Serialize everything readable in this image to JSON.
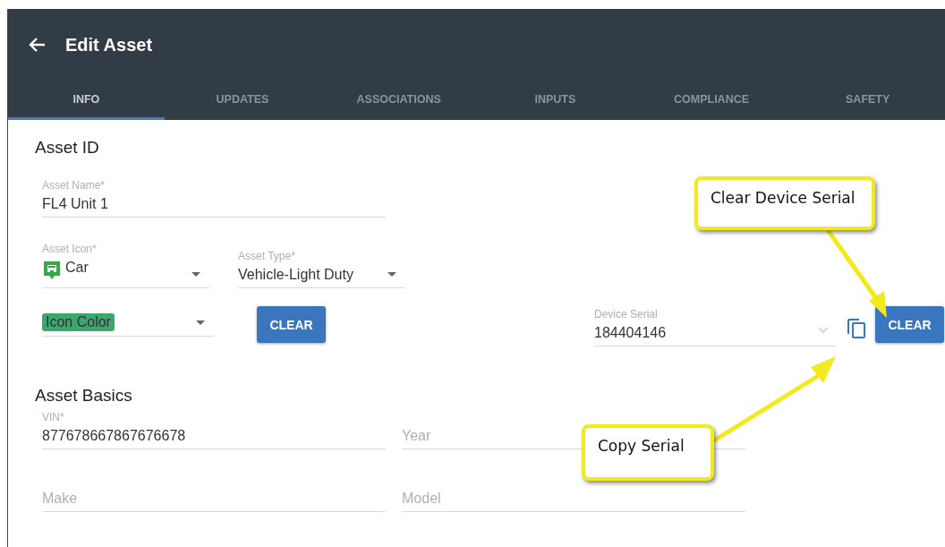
{
  "header": {
    "title": "Edit Asset"
  },
  "tabs": [
    {
      "label": "INFO",
      "selected": true
    },
    {
      "label": "UPDATES",
      "selected": false
    },
    {
      "label": "ASSOCIATIONS",
      "selected": false
    },
    {
      "label": "INPUTS",
      "selected": false
    },
    {
      "label": "COMPLIANCE",
      "selected": false
    },
    {
      "label": "SAFETY",
      "selected": false
    }
  ],
  "asset_id": {
    "title": "Asset ID",
    "asset_name": {
      "label": "Asset Name*",
      "value": "FL4 Unit 1"
    },
    "asset_icon": {
      "label": "Asset Icon*",
      "value": "Car"
    },
    "asset_type": {
      "label": "Asset Type*",
      "value": "Vehicle-Light Duty"
    },
    "icon_color": {
      "placeholder": "Icon Color"
    },
    "clear_button": "CLEAR",
    "device_serial": {
      "label": "Device Serial",
      "value": "184404146"
    },
    "serial_clear_button": "CLEAR"
  },
  "asset_basics": {
    "title": "Asset Basics",
    "fields": [
      {
        "label": "VIN*",
        "value": "877678667867676678"
      },
      {
        "placeholder": "Year"
      },
      {
        "placeholder": "Make"
      },
      {
        "placeholder": "Model"
      }
    ]
  },
  "callouts": [
    {
      "text": "Clear Device Serial"
    },
    {
      "text": "Copy Serial"
    }
  ]
}
